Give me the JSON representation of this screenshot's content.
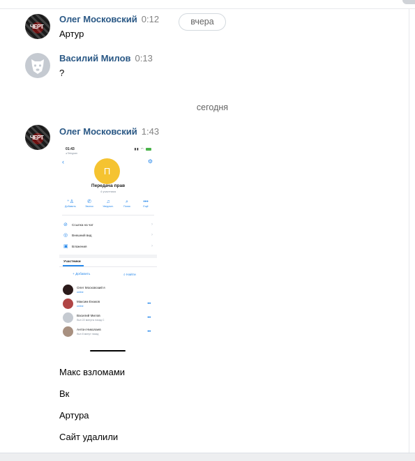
{
  "date_separators": {
    "yesterday": "вчера",
    "today": "сегодня"
  },
  "messages": [
    {
      "author": "Олег Московский",
      "time": "0:12",
      "text": "Артур",
      "avatar_text": "ЧЕРТ"
    },
    {
      "author": "Василий Милов",
      "time": "0:13",
      "text": "?"
    },
    {
      "author": "Олег Московский",
      "time": "1:43",
      "avatar_text": "ЧЕРТ"
    }
  ],
  "screenshot": {
    "status_time": "01:43",
    "status_sub": "◂ Telegram",
    "group_initial": "П",
    "group_title": "Передача прав",
    "group_subtitle": "4 участника",
    "actions": [
      {
        "icon": "add-user-icon",
        "label": "Добавить"
      },
      {
        "icon": "phone-icon",
        "label": "Звонок"
      },
      {
        "icon": "bell-icon",
        "label": "Уведомл."
      },
      {
        "icon": "search-icon",
        "label": "Поиск"
      },
      {
        "icon": "more-icon",
        "label": "Ещё"
      }
    ],
    "rows": [
      {
        "icon": "link-icon",
        "label": "Ссылка на чат"
      },
      {
        "icon": "palette-icon",
        "label": "Внешний вид"
      },
      {
        "icon": "attachment-icon",
        "label": "Вложения"
      }
    ],
    "members_tab": "Участники",
    "add_label": "+ Добавить",
    "find_label": "Найти",
    "members": [
      {
        "name": "Олег Московский я",
        "status": "online",
        "color": "#2b1a1a"
      },
      {
        "name": "Максим Енаков",
        "status": "online",
        "color": "#b04545"
      },
      {
        "name": "Василий Милов",
        "status": "был 22 минуты назад С",
        "color": "#c5cad1"
      },
      {
        "name": "Антон Николаев",
        "status": "был 8 минут назад",
        "color": "#a89080"
      }
    ]
  },
  "followups": [
    "Макс взломами",
    "Вк",
    "Артура",
    "Сайт удалили"
  ],
  "colors": {
    "author": "#2a5885",
    "accent": "#2688eb",
    "muted": "#828282"
  }
}
